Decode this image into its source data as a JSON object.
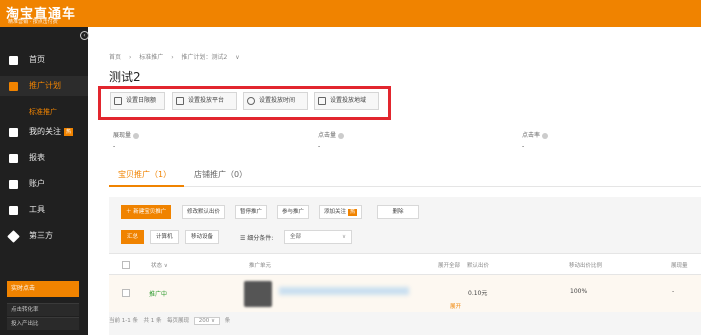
{
  "brand": {
    "name": "淘宝直通车",
    "tagline": "精准营销 · 按点击付费"
  },
  "sidebar": {
    "collapse_glyph": "‹",
    "items": [
      {
        "label": "首页",
        "icon": "home-icon"
      },
      {
        "label": "推广计划",
        "icon": "briefcase-icon"
      },
      {
        "label": "我的关注",
        "icon": "heart-icon",
        "badge": "热"
      },
      {
        "label": "报表",
        "icon": "report-icon"
      },
      {
        "label": "账户",
        "icon": "account-icon"
      },
      {
        "label": "工具",
        "icon": "toolbox-icon"
      },
      {
        "label": "第三方",
        "icon": "diamond-icon"
      }
    ],
    "active_index": 1,
    "subitem": "标准推广",
    "realtime": {
      "title": "实时点击",
      "rows": [
        "点击转化率",
        "投入产出比"
      ]
    }
  },
  "breadcrumb": [
    "首页",
    "›",
    "标准推广",
    "›",
    "推广计划：测试2",
    "∨"
  ],
  "plan_title": "测试2",
  "settings_buttons": [
    {
      "label": "设置日限额",
      "icon": "budget-icon"
    },
    {
      "label": "设置投放平台",
      "icon": "platform-icon"
    },
    {
      "label": "设置投放时间",
      "icon": "clock-icon"
    },
    {
      "label": "设置投放地域",
      "icon": "region-icon"
    }
  ],
  "metrics": [
    {
      "label": "展现量",
      "value": "-"
    },
    {
      "label": "点击量",
      "value": "-"
    },
    {
      "label": "点击率",
      "value": "-"
    }
  ],
  "tabs": [
    {
      "label": "宝贝推广（1）"
    },
    {
      "label": "店铺推广（0）"
    }
  ],
  "toolbar": {
    "new_label": "＋ 新建宝贝推广",
    "bid_label": "修改默认出价",
    "pause_label": "暂停推广",
    "resume_label": "参与推广",
    "follow_label": "添加关注",
    "follow_badge": "热",
    "delete_label": "删除"
  },
  "segments": [
    "汇总",
    "计算机",
    "移动设备"
  ],
  "filter": {
    "label": "细分条件:",
    "value": "全部"
  },
  "table": {
    "headers": [
      "状态",
      "推广单元",
      "展开全部",
      "默认出价",
      "移动出价比例",
      "展现量"
    ],
    "status_chevron": "∨",
    "row": {
      "status": "推广中",
      "bid": "0.10元",
      "ratio": "100%",
      "impressions": "-",
      "expand": "展开"
    }
  },
  "pagination": {
    "summary": "当前 1-1 条　共 1 条　每页展现",
    "per_page": "200",
    "per_page_chevron": "∨",
    "unit": "条"
  },
  "colors": {
    "accent": "#f08300",
    "sidebar_bg": "#202020",
    "highlight_border": "#e2262e"
  }
}
